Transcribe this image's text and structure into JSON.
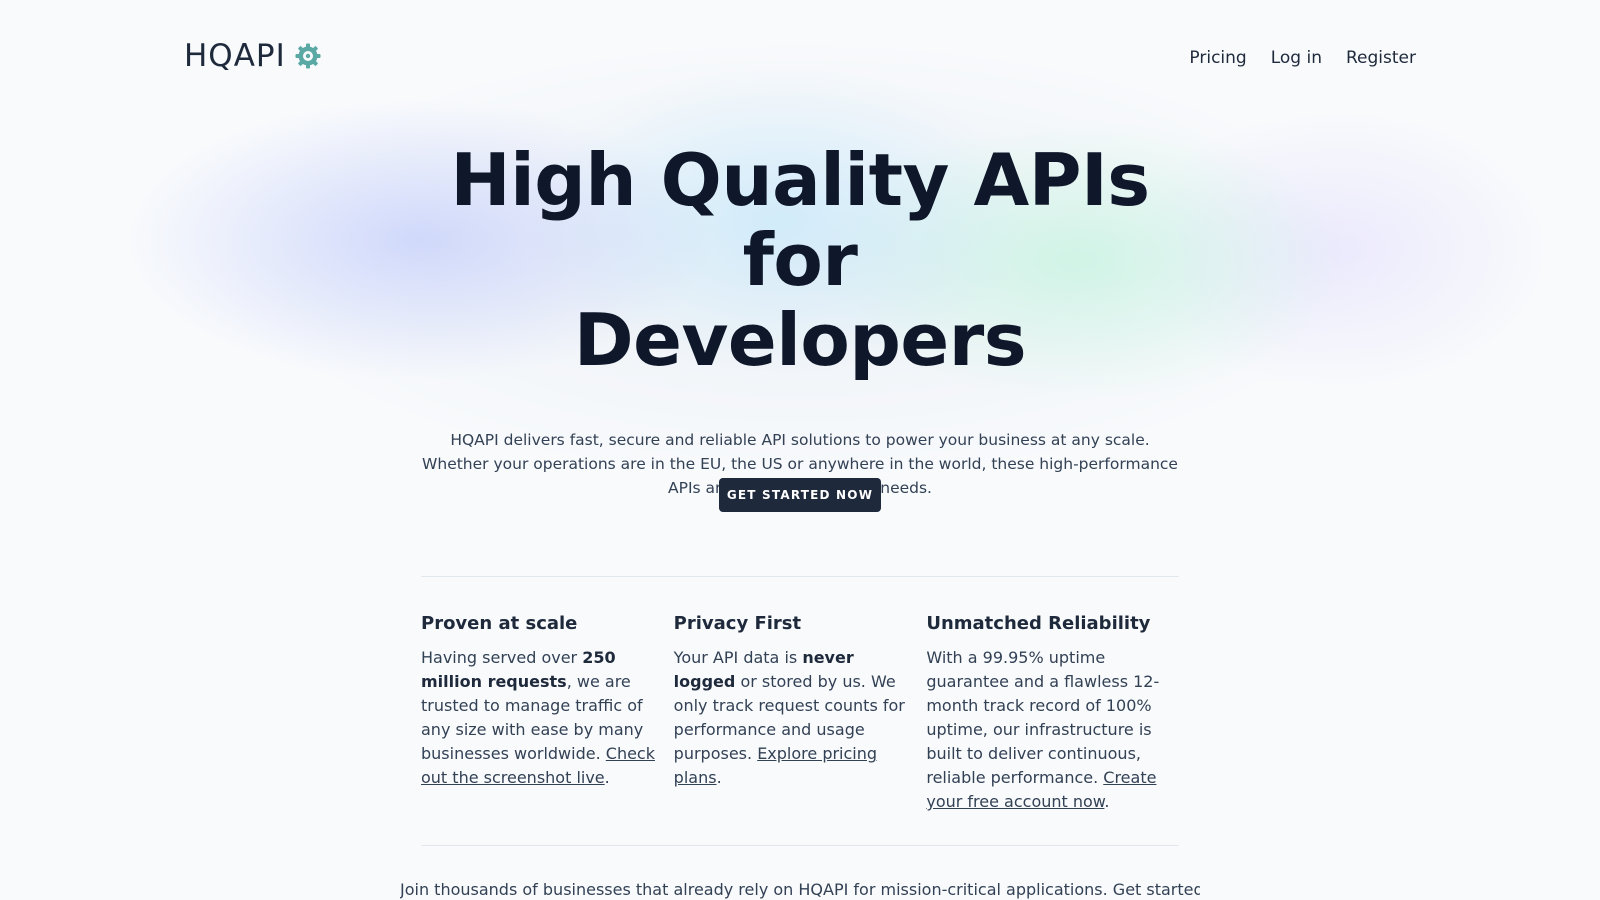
{
  "header": {
    "logo_text": "HQAPI",
    "logo_icon": "gear-icon",
    "nav": [
      {
        "label": "Pricing"
      },
      {
        "label": "Log in"
      },
      {
        "label": "Register"
      }
    ]
  },
  "hero": {
    "title_line1": "High Quality APIs for",
    "title_line2": "Developers",
    "subtitle": "HQAPI delivers fast, secure and reliable API solutions to power your business at any scale. Whether your operations are in the EU, the US or anywhere in the world, these high-performance APIs are built to meet your needs.",
    "cta_label": "GET STARTED NOW"
  },
  "features": [
    {
      "title": "Proven at scale",
      "text_before": "Having served over ",
      "bold": "250 million requests",
      "text_after": ", we are trusted to manage traffic of any size with ease by many businesses worldwide. ",
      "link": "Check out the screenshot live",
      "end": "."
    },
    {
      "title": "Privacy First",
      "text_before": "Your API data is ",
      "bold": "never logged",
      "text_after": " or stored by us. We only track request counts for performance and usage purposes. ",
      "link": "Explore pricing plans",
      "end": "."
    },
    {
      "title": "Unmatched Reliability",
      "text_before": "With a 99.95% uptime guarantee and a flawless 12-month track record of 100% uptime, our infrastructure is built to deliver continuous, reliable performance. ",
      "bold": "",
      "text_after": "",
      "link": "Create your free account now",
      "end": "."
    }
  ],
  "closing": "Join thousands of businesses that already rely on HQAPI for mission-critical applications. Get started",
  "colors": {
    "accent_gear": "#5aa9a4",
    "button_bg": "#1e293b",
    "heading": "#0f172a"
  }
}
